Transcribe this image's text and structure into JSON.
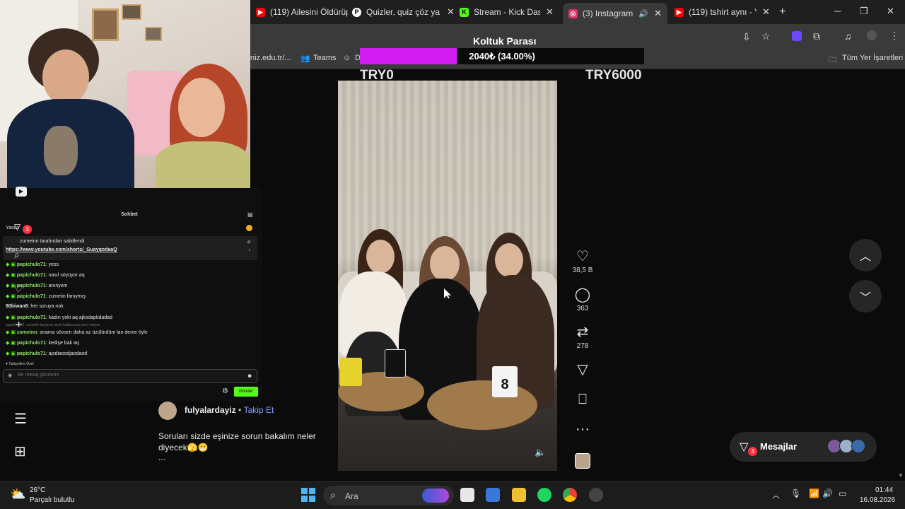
{
  "tabs": [
    {
      "title": "(119) Ailesini Öldürüp",
      "favicon": "youtube-icon",
      "color": "#ff0000"
    },
    {
      "title": "Quizler, quiz çöz ya c",
      "favicon": "quiz-icon",
      "color": "#ffffff"
    },
    {
      "title": "Stream - Kick Dashb",
      "favicon": "kick-icon",
      "color": "#53fc18"
    },
    {
      "title": "(3) Instagram",
      "favicon": "instagram-icon",
      "color": "#e1306c"
    },
    {
      "title": "(119) tshirt aynı - Yo",
      "favicon": "youtube-icon",
      "color": "#ff0000"
    }
  ],
  "bookmarks": {
    "partial_url": "niz.edu.tr/...",
    "teams": "Teams",
    "d_partial": "D",
    "all_bookmarks": "Tüm Yer İşaretleri"
  },
  "overlay": {
    "title": "Koltuk Parası",
    "progress_text": "2040₺ (34.00%)",
    "progress_fraction": 0.34,
    "accent": "#d21ef0",
    "min_label": "TRY0",
    "max_label": "TRY6000"
  },
  "post": {
    "likes": "38,5 B",
    "comments": "363",
    "reposts": "278",
    "author": "fulyalardayiz",
    "separator": "•",
    "follow": "Takip Et",
    "caption": "Soruları sizde eşinize sorun bakalım neler diyecek🫣😬",
    "ellipsis": "...",
    "mug_number": "8"
  },
  "messages": {
    "label": "Mesajlar",
    "badge": "3"
  },
  "sidebar_badge": "3",
  "chat": {
    "title": "Sohbet",
    "user_label": "Yasuo",
    "pinned_by": "zumeinn tarafından sabitlendi",
    "pinned_link": "https://www.youtube.com/shorts/_GuayqodaaQ",
    "lines": [
      {
        "user": "papichulo71",
        "text": "yess"
      },
      {
        "user": "papichulo71",
        "text": "nasıl söyüyor aq"
      },
      {
        "user": "papichulo71",
        "text": "anınyom"
      },
      {
        "user": "papichulo71",
        "text": "zumeiin fanıymış"
      },
      {
        "user": "90biwan6",
        "text": "her soruya nok"
      },
      {
        "user": "papichulo71",
        "text": "kadın yoki aq ajksdapkdadad"
      },
      {
        "user": "zumeinn",
        "text": "anama sövsen daha az üzülürdüm lan deme öyle"
      },
      {
        "user": "papichulo71",
        "text": "kedişe bak aq"
      },
      {
        "user": "papichulo71",
        "text": "ajsdiaosdjaodaod"
      }
    ],
    "reply_hint": "papichulo71: zumeiin fanıymış isimli kullanıcıya yanıt veriyor",
    "followers_only": "Takipçilere Özel",
    "input_placeholder": "Bir mesaj gönderin",
    "send": "Gönder"
  },
  "taskbar": {
    "temperature": "26°C",
    "weather": "Parçalı bulutlu",
    "search": "Ara",
    "time": "01:44",
    "date": "16.08.2026"
  }
}
